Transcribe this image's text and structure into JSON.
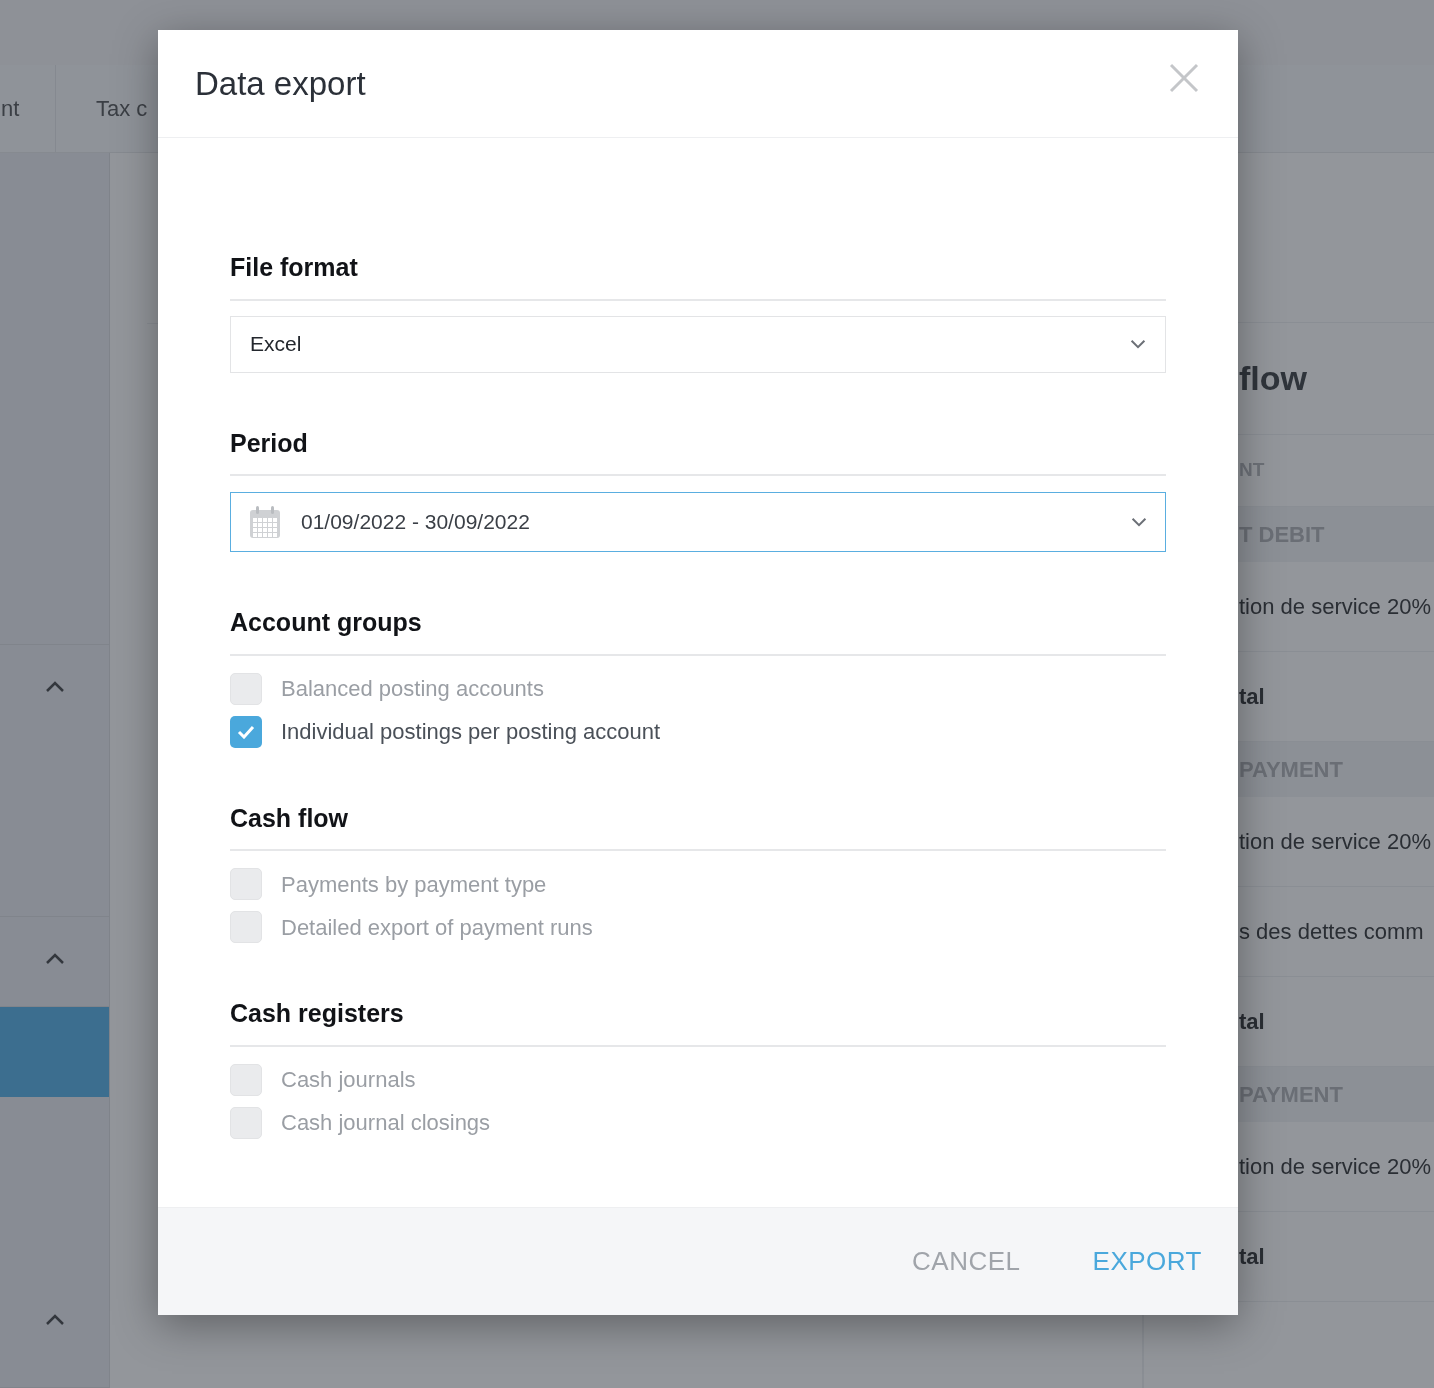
{
  "background": {
    "tabs": [
      {
        "label": "nt"
      },
      {
        "label": "Tax c"
      }
    ],
    "sidebar": {
      "items": [
        {
          "kind": "section",
          "expanded": true
        },
        {
          "kind": "section",
          "expanded": true
        },
        {
          "kind": "item",
          "selected": true
        },
        {
          "kind": "section",
          "expanded": true
        }
      ]
    },
    "right_panel": {
      "title": "flow",
      "rows": [
        {
          "kind": "header",
          "text": "NT"
        },
        {
          "kind": "group",
          "text": "T DEBIT"
        },
        {
          "kind": "line",
          "text": "tion de service 20%"
        },
        {
          "kind": "total",
          "text": "tal"
        },
        {
          "kind": "group",
          "text": "PAYMENT"
        },
        {
          "kind": "line",
          "text": "tion de service 20%"
        },
        {
          "kind": "line",
          "text": "s des dettes comm"
        },
        {
          "kind": "total",
          "text": "tal"
        },
        {
          "kind": "group",
          "text": "PAYMENT"
        },
        {
          "kind": "line",
          "text": "tion de service 20%"
        },
        {
          "kind": "total",
          "text": "tal"
        }
      ]
    }
  },
  "dialog": {
    "title": "Data export",
    "sections": [
      {
        "title": "File format",
        "kind": "select",
        "value": "Excel"
      },
      {
        "title": "Period",
        "kind": "date_range",
        "value": "01/09/2022 - 30/09/2022"
      },
      {
        "title": "Account groups",
        "kind": "checkboxes",
        "options": [
          {
            "label": "Balanced posting accounts",
            "checked": false
          },
          {
            "label": "Individual postings per posting account",
            "checked": true
          }
        ]
      },
      {
        "title": "Cash flow",
        "kind": "checkboxes",
        "options": [
          {
            "label": "Payments by payment type",
            "checked": false
          },
          {
            "label": "Detailed export of payment runs",
            "checked": false
          }
        ]
      },
      {
        "title": "Cash registers",
        "kind": "checkboxes",
        "options": [
          {
            "label": "Cash journals",
            "checked": false
          },
          {
            "label": "Cash journal closings",
            "checked": false
          }
        ]
      }
    ],
    "buttons": [
      {
        "label": "CANCEL",
        "kind": "secondary"
      },
      {
        "label": "EXPORT",
        "kind": "primary"
      }
    ]
  }
}
